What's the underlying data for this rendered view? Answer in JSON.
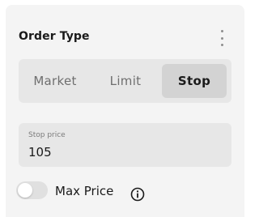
{
  "panel": {
    "title": "Order Type",
    "menu_icon": "more-vertical-icon"
  },
  "order_type": {
    "options": [
      "Market",
      "Limit",
      "Stop"
    ],
    "selected": "Stop"
  },
  "stop_price": {
    "label": "Stop price",
    "value": "105"
  },
  "max_price": {
    "label": "Max Price",
    "enabled": false,
    "info_icon": "info-icon"
  },
  "colors": {
    "card_bg": "#f4f4f4",
    "segment_bg": "#e7e7e7",
    "selected_bg": "#d3d3d3",
    "text": "#1a1a1a",
    "muted_text": "#6f6f6f"
  }
}
